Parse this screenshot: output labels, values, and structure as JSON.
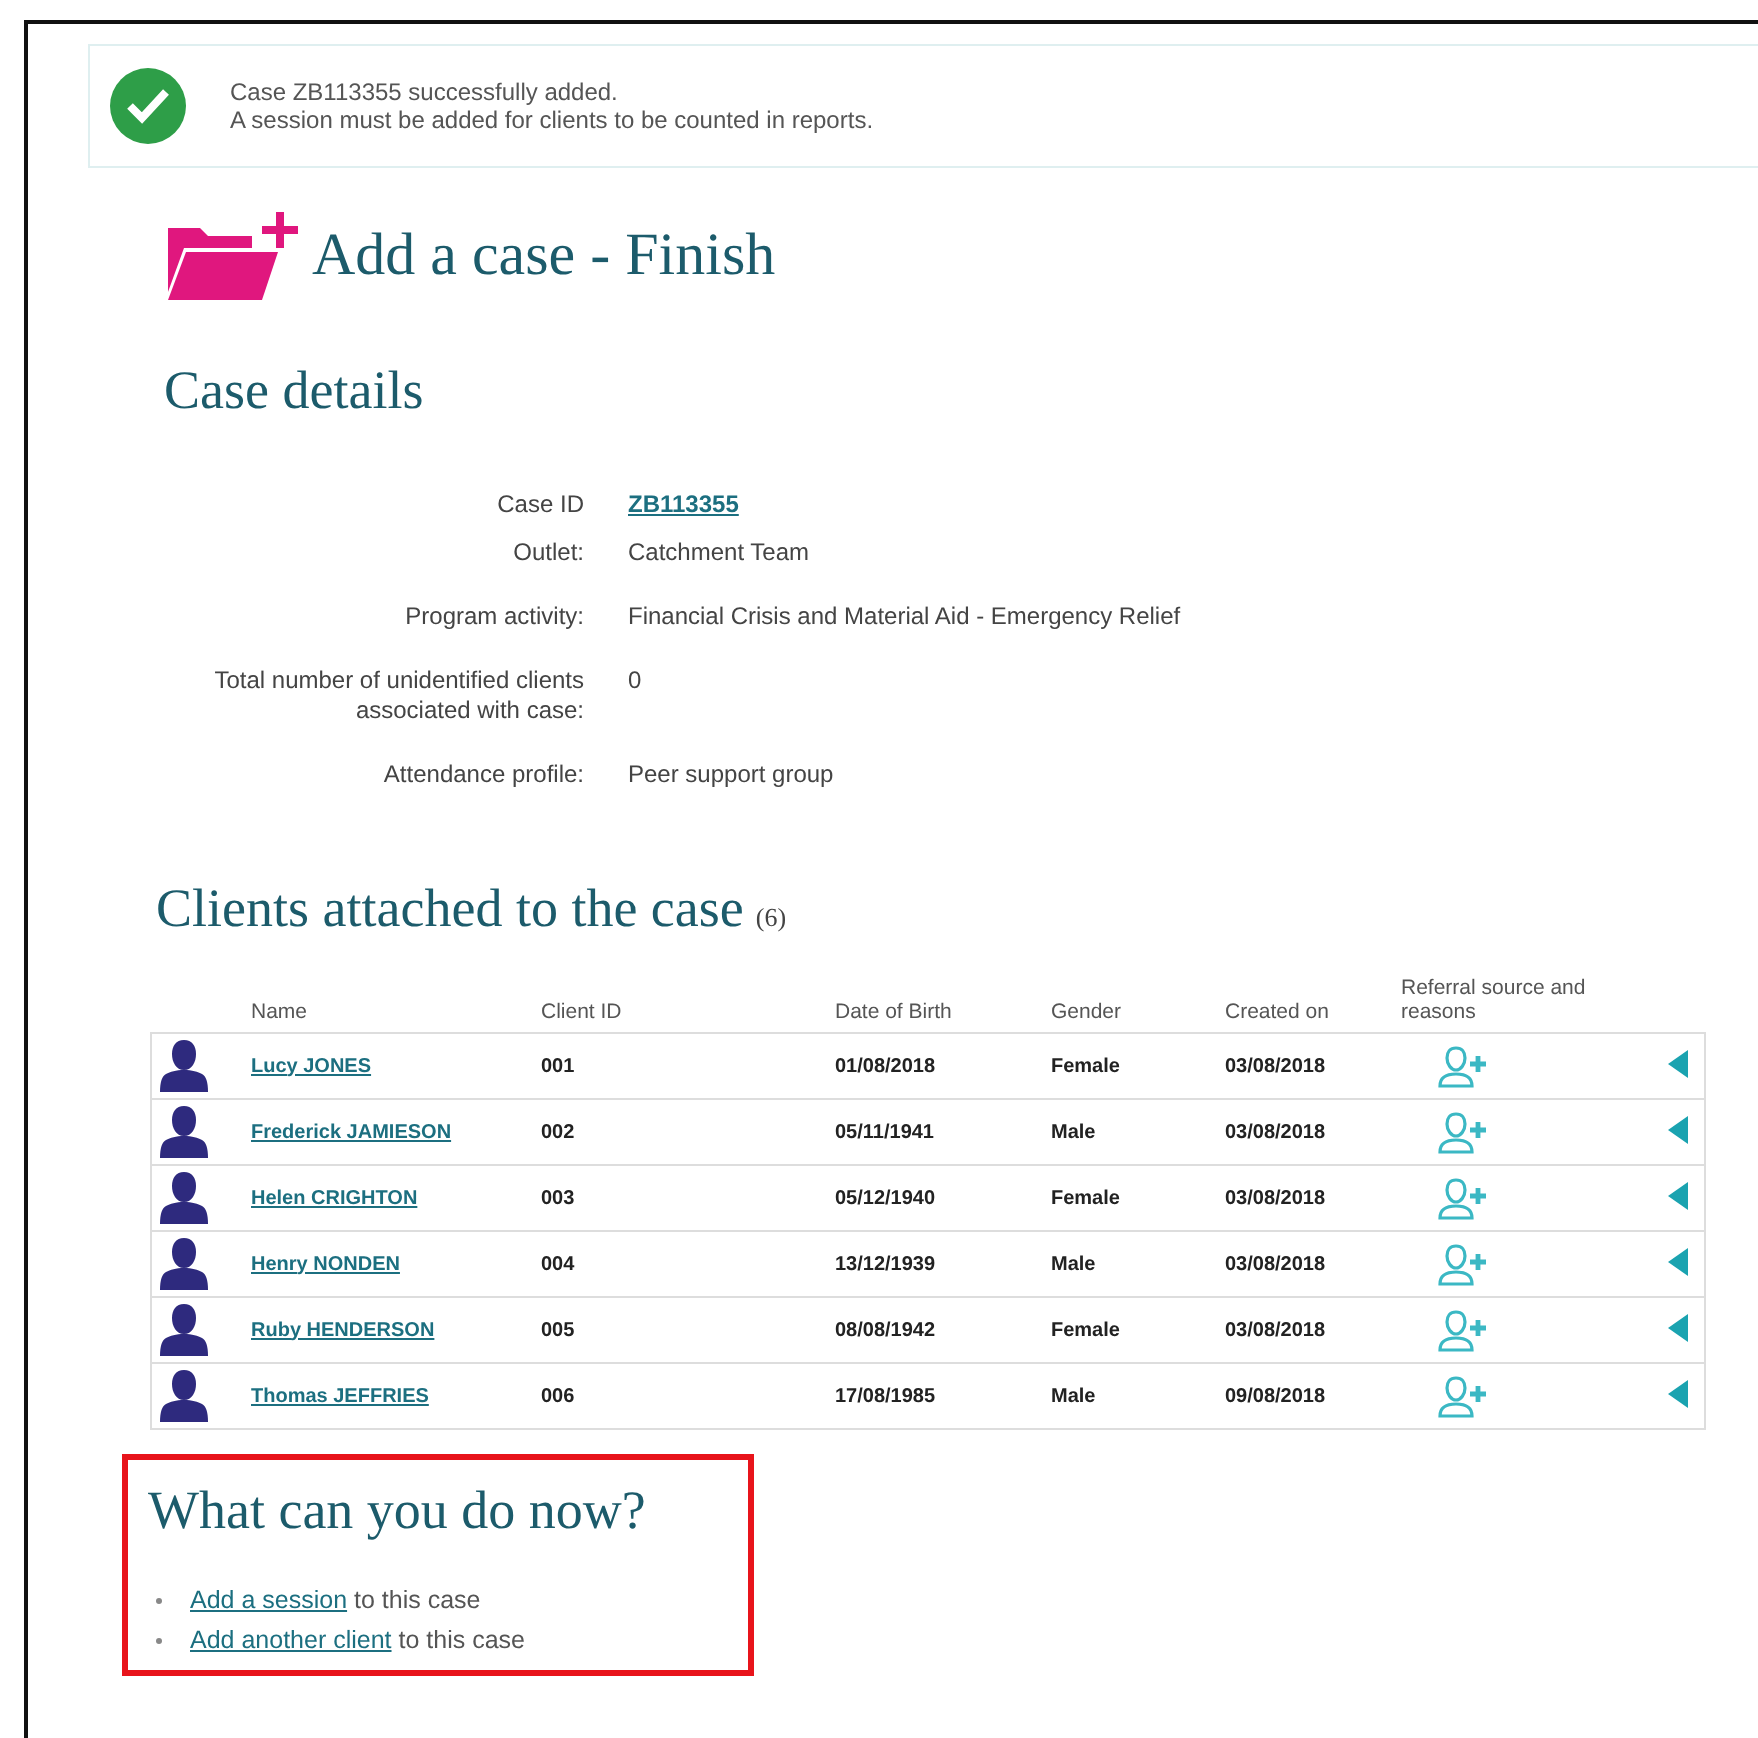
{
  "notification": {
    "lines": [
      "Case ZB113355 successfully added.",
      "A session must be added for clients to be counted in reports."
    ]
  },
  "page_title": "Add a case - Finish",
  "case_details": {
    "heading": "Case details",
    "fields": [
      {
        "label": "Case ID",
        "value": "ZB113355",
        "kind": "link"
      },
      {
        "label": "Outlet:",
        "value": "Catchment Team",
        "kind": "text"
      },
      {
        "label": "Program activity:",
        "value": "Financial Crisis and Material Aid - Emergency Relief",
        "kind": "text"
      },
      {
        "label": "Total number of unidentified clients associated with case:",
        "value": "0",
        "kind": "text"
      },
      {
        "label": "Attendance profile:",
        "value": "Peer support group",
        "kind": "text"
      }
    ]
  },
  "clients": {
    "heading": "Clients attached to the case",
    "count": "(6)",
    "columns": [
      "Name",
      "Client ID",
      "Date of Birth",
      "Gender",
      "Created on",
      "Referral source and reasons"
    ],
    "rows": [
      {
        "name": "Lucy JONES",
        "client_id": "001",
        "date_of_birth": "01/08/2018",
        "gender": "Female",
        "created_on": "03/08/2018"
      },
      {
        "name": "Frederick JAMIESON",
        "client_id": "002",
        "date_of_birth": "05/11/1941",
        "gender": "Male",
        "created_on": "03/08/2018"
      },
      {
        "name": "Helen CRIGHTON",
        "client_id": "003",
        "date_of_birth": "05/12/1940",
        "gender": "Female",
        "created_on": "03/08/2018"
      },
      {
        "name": "Henry NONDEN",
        "client_id": "004",
        "date_of_birth": "13/12/1939",
        "gender": "Male",
        "created_on": "03/08/2018"
      },
      {
        "name": "Ruby HENDERSON",
        "client_id": "005",
        "date_of_birth": "08/08/1942",
        "gender": "Female",
        "created_on": "03/08/2018"
      },
      {
        "name": "Thomas JEFFRIES",
        "client_id": "006",
        "date_of_birth": "17/08/1985",
        "gender": "Male",
        "created_on": "09/08/2018"
      }
    ]
  },
  "next_steps": {
    "heading": "What can you do now?",
    "items": [
      {
        "link": "Add a session",
        "text": "to this case"
      },
      {
        "link": "Add another client",
        "text": "to this case"
      }
    ]
  }
}
